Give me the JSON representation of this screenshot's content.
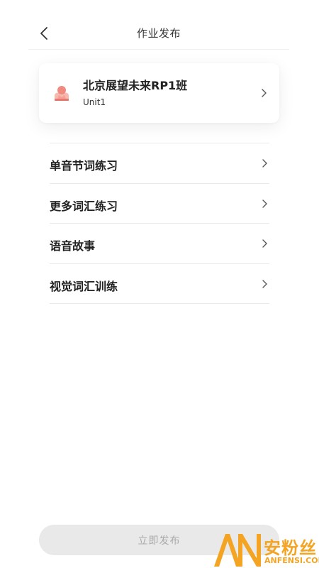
{
  "header": {
    "title": "作业发布",
    "back_icon": "chevron-left-icon"
  },
  "class_card": {
    "name": "北京展望未来RP1班",
    "unit": "Unit1",
    "avatar_icon": "class-avatar-icon",
    "avatar_color": "#f08a7e"
  },
  "menu": {
    "items": [
      {
        "label": "单音节词练习"
      },
      {
        "label": "更多词汇练习"
      },
      {
        "label": "语音故事"
      },
      {
        "label": "视觉词汇训练"
      }
    ]
  },
  "footer": {
    "publish_label": "立即发布",
    "publish_state": "disabled"
  },
  "watermark": {
    "text_cn": "安粉丝",
    "text_en": "ANFENSI.COM",
    "color": "#f3a422"
  }
}
